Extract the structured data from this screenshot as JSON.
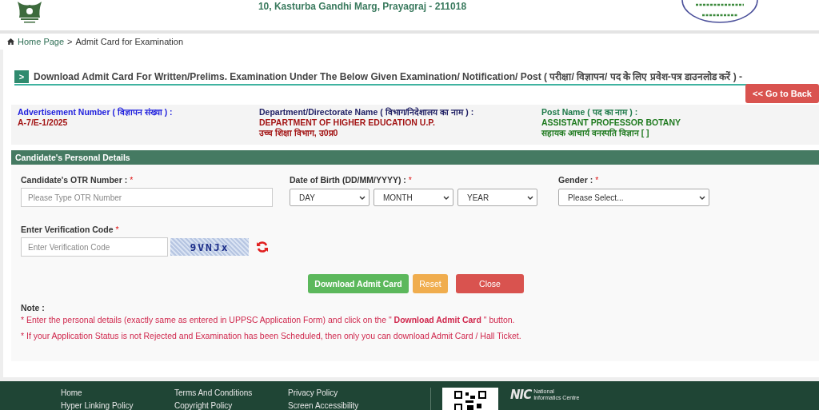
{
  "header": {
    "address": "10, Kasturba Gandhi Marg, Prayagraj - 211018"
  },
  "breadcrumb": {
    "home": "Home Page",
    "separator": ">",
    "current": "Admit Card for Examination"
  },
  "heading": {
    "badge": ">",
    "title": "Download Admit Card For Written/Prelims. Examination Under The Below Given Examination/ Notification/ Post ( परीक्षा/ विज्ञापन/ पद के लिए प्रवेश-पत्र डाउनलोड करें ) -"
  },
  "back_button": "<< Go to Back",
  "info": [
    {
      "kind": "advertisement",
      "label": "Advertisement Number ( विज्ञापन संख्या ) :",
      "values": [
        "A-7/E-1/2025"
      ]
    },
    {
      "kind": "department",
      "label": "Department/Directorate Name ( विभाग/निदेशालय का नाम ) :",
      "values": [
        "DEPARTMENT OF HIGHER EDUCATION U.P.",
        "उच्च शिक्षा विभाग, उ0प्र0"
      ]
    },
    {
      "kind": "post",
      "label": "Post Name ( पद का नाम ) :",
      "values": [
        "ASSISTANT PROFESSOR BOTANY",
        "सहायक आचार्य वनस्पति विज्ञान [ ]"
      ]
    }
  ],
  "section_title": "Candidate's Personal Details",
  "fields": [
    {
      "kind": "text",
      "label": "Candidate's OTR Number :",
      "required_mark": "*",
      "placeholder": "Please Type OTR Number"
    },
    {
      "kind": "selects",
      "label": "Date of Birth (DD/MM/YYYY) :",
      "required_mark": "*",
      "options": [
        "DAY",
        "MONTH",
        "YEAR"
      ]
    },
    {
      "kind": "select",
      "label": "Gender :",
      "required_mark": "*",
      "options": [
        "Please Select..."
      ]
    }
  ],
  "verification": {
    "label": "Enter Verification Code",
    "required_mark": "*",
    "placeholder": "Enter Verification Code",
    "captcha": "9VNJx"
  },
  "buttons": [
    {
      "kind": "primary",
      "label": "Download Admit Card"
    },
    {
      "kind": "warning",
      "label": "Reset"
    },
    {
      "kind": "danger",
      "label": "Close"
    }
  ],
  "note": {
    "title": "Note :",
    "lines": [
      "* Enter the personal details (exactly same as entered in UPPSC Application Form) and click on the \" **Download Admit Card** \" button.",
      "* If your Application Status is not Rejected and Examination has been Scheduled, then only you can download Admit Card / Hall Ticket."
    ]
  },
  "footer": {
    "columns": [
      [
        "Home",
        "Hyper Linking Policy"
      ],
      [
        "Terms And Conditions",
        "Copyright Policy"
      ],
      [
        "Privacy Policy",
        "Screen Accessibility"
      ]
    ],
    "nic_logo": "NIC",
    "nic_caption": "National Informatics Centre"
  }
}
